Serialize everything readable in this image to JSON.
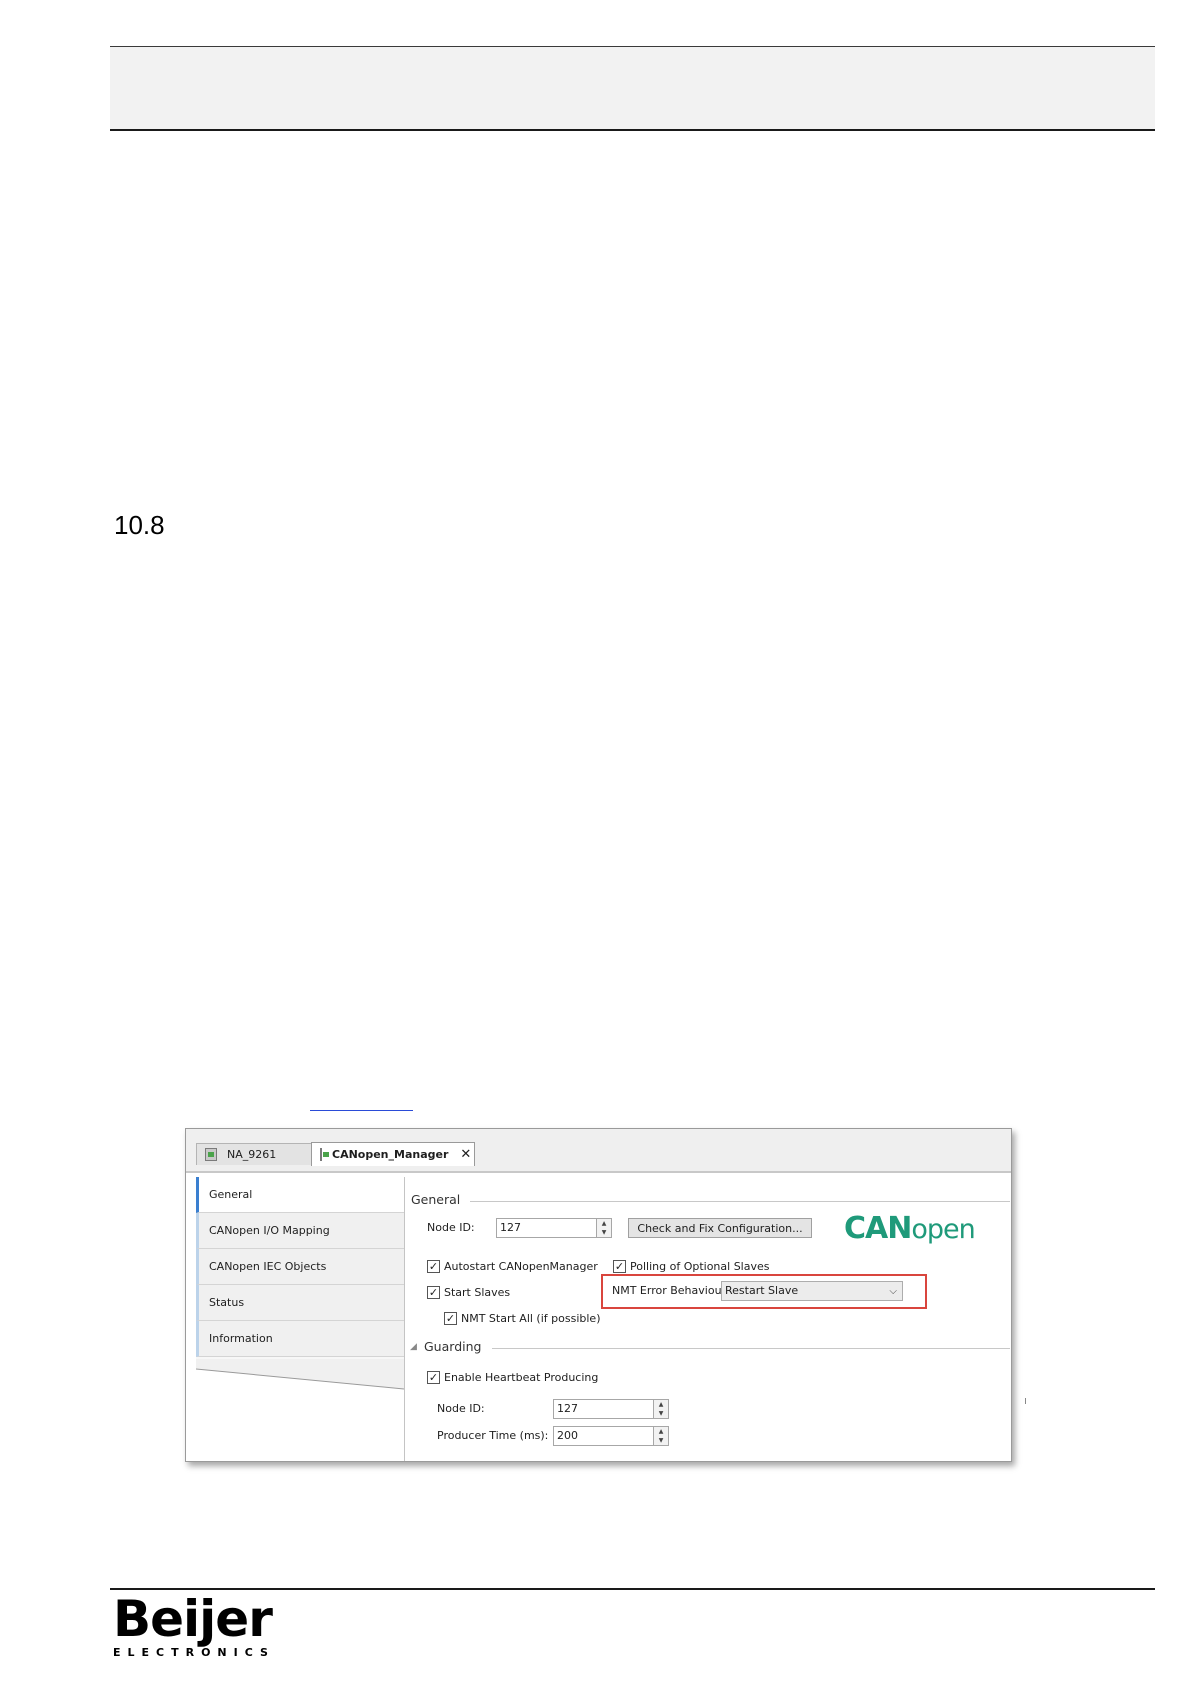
{
  "document": {
    "section_number": "10.8"
  },
  "window": {
    "tabs": [
      {
        "label": "NA_9261"
      },
      {
        "label": "CANopen_Manager"
      }
    ],
    "close_glyph": "✕",
    "nav_items": [
      {
        "label": "General"
      },
      {
        "label": "CANopen I/O Mapping"
      },
      {
        "label": "CANopen IEC Objects"
      },
      {
        "label": "Status"
      },
      {
        "label": "Information"
      }
    ],
    "general": {
      "title": "General",
      "node_id_label": "Node ID:",
      "node_id_value": "127",
      "check_fix_button": "Check and Fix Configuration...",
      "autostart": {
        "label": "Autostart CANopenManager",
        "checked": true
      },
      "polling": {
        "label": "Polling of Optional Slaves",
        "checked": true
      },
      "start_slaves": {
        "label": "Start Slaves",
        "checked": true
      },
      "nmt_start_all": {
        "label": "NMT Start All (if possible)",
        "checked": true
      },
      "nmt_error_label": "NMT Error Behaviour:",
      "nmt_error_value": "Restart Slave"
    },
    "guarding": {
      "title": "Guarding",
      "heartbeat": {
        "label": "Enable Heartbeat Producing",
        "checked": true
      },
      "node_id_label": "Node ID:",
      "node_id_value": "127",
      "producer_time_label": "Producer Time (ms):",
      "producer_time_value": "200"
    },
    "logo": {
      "bold": "CAN",
      "light": "open",
      "color": "#1f9a7a"
    },
    "highlight_color": "#d9453d",
    "check_glyph": "✓",
    "spin_up": "▲",
    "spin_down": "▼",
    "dropdown_glyph": "⌵",
    "collapse_glyph": "◢"
  },
  "footer": {
    "logo_word": "Beijer",
    "logo_sub": "ELECTRONICS"
  }
}
